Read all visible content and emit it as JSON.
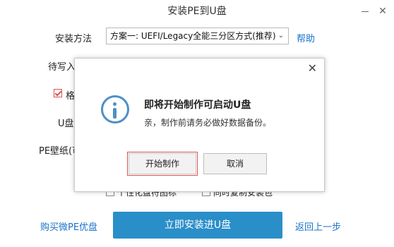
{
  "window": {
    "title": "安装PE到U盘"
  },
  "form": {
    "install_method_label": "安装方法",
    "install_method_value": "方案一: UEFI/Legacy全能三分区方式(推荐)",
    "help_link": "帮助",
    "pending_label": "待写入",
    "format_label": "格",
    "udisk_label": "U盘",
    "wallpaper_label": "PE壁纸(可",
    "option1_label": "个性化盘符图标",
    "option2_label": "同时复制安装包"
  },
  "footer": {
    "buy_link": "购买微PE优盘",
    "primary_button": "立即安装进U盘",
    "back_link": "返回上一步"
  },
  "dialog": {
    "title": "即将开始制作可启动U盘",
    "message": "亲，制作前请务必做好数据备份。",
    "start_button": "开始制作",
    "cancel_button": "取消",
    "close_glyph": "✕"
  },
  "colors": {
    "accent": "#2a8ec9",
    "link": "#1a73c9",
    "info_icon": "#4d8fc7",
    "focus": "#d9534f"
  }
}
